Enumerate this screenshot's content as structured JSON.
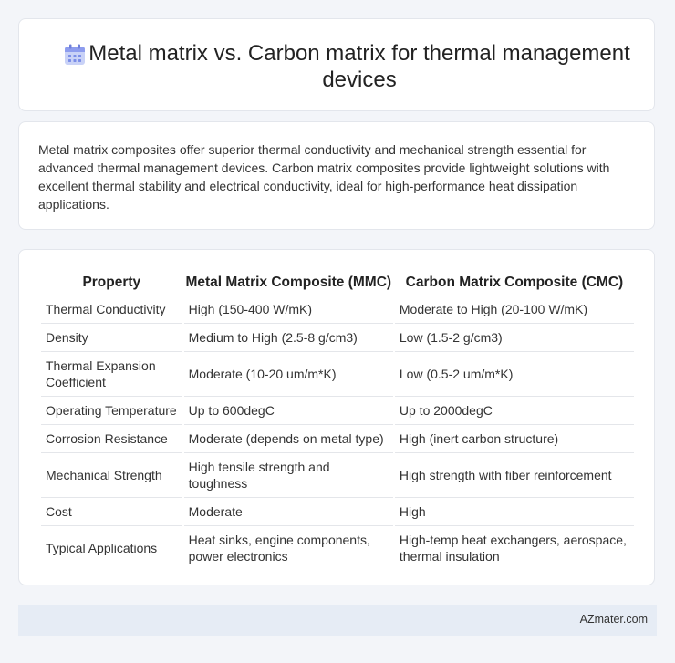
{
  "header": {
    "icon": "calendar-icon",
    "title": "Metal matrix vs. Carbon matrix for thermal management devices"
  },
  "intro": "Metal matrix composites offer superior thermal conductivity and mechanical strength essential for advanced thermal management devices. Carbon matrix composites provide lightweight solutions with excellent thermal stability and electrical conductivity, ideal for high-performance heat dissipation applications.",
  "table": {
    "headers": [
      "Property",
      "Metal Matrix Composite (MMC)",
      "Carbon Matrix Composite (CMC)"
    ],
    "rows": [
      [
        "Thermal Conductivity",
        "High (150-400 W/mK)",
        "Moderate to High (20-100 W/mK)"
      ],
      [
        "Density",
        "Medium to High (2.5-8 g/cm3)",
        "Low (1.5-2 g/cm3)"
      ],
      [
        "Thermal Expansion Coefficient",
        "Moderate (10-20 um/m*K)",
        "Low (0.5-2 um/m*K)"
      ],
      [
        "Operating Temperature",
        "Up to 600degC",
        "Up to 2000degC"
      ],
      [
        "Corrosion Resistance",
        "Moderate (depends on metal type)",
        "High (inert carbon structure)"
      ],
      [
        "Mechanical Strength",
        "High tensile strength and toughness",
        "High strength with fiber reinforcement"
      ],
      [
        "Cost",
        "Moderate",
        "High"
      ],
      [
        "Typical Applications",
        "Heat sinks, engine components, power electronics",
        "High-temp heat exchangers, aerospace, thermal insulation"
      ]
    ]
  },
  "footer": {
    "brand": "AZmater.com"
  },
  "colors": {
    "accent": "#7b8ee8",
    "footer_bg": "#e6ecf5",
    "page_bg": "#f3f5f9"
  }
}
